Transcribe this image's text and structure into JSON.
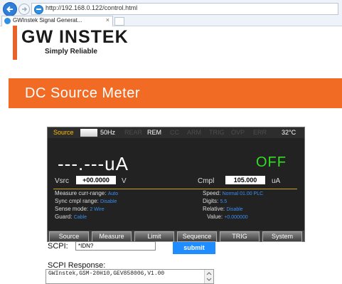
{
  "browser": {
    "url": "http://192.168.0.122/control.html",
    "tab_title": "GWInstek Signal Generat...",
    "tab_close": "×"
  },
  "header": {
    "logo_text": "GW INSTEK",
    "slogan": "Simply  Reliable",
    "page_title": "DC Source Meter",
    "brand_color": "#f26b25"
  },
  "instrument": {
    "status": {
      "source": "Source",
      "freq": "50Hz",
      "rear": "REAR",
      "rem": "REM",
      "cc": "CC",
      "arm": "ARM",
      "trig": "TRIG",
      "ovp": "OVP",
      "err": "ERR",
      "temp": "32°C"
    },
    "reading": "---.---uA",
    "output_state": "OFF",
    "vsrc_label": "Vsrc",
    "vsrc_value": "+00.0000",
    "vsrc_unit": "V",
    "cmpl_label": "Cmpl",
    "cmpl_value": "105.000",
    "cmpl_unit": "uA",
    "settings": {
      "measure_range_label": "Measure curr-range:",
      "measure_range_value": "Auto",
      "sync_cmpl_label": "Sync cmpl range:",
      "sync_cmpl_value": "Disable",
      "sense_label": "Sense mode:",
      "sense_value": "2 Wire",
      "guard_label": "Guard:",
      "guard_value": "Cable",
      "speed_label": "Speed:",
      "speed_value": "Normal  01.00 PLC",
      "digits_label": "Digits:",
      "digits_value": "5.5",
      "relative_label": "Relative:",
      "relative_value": "Disable",
      "value_label": "Value:",
      "value_value": "+0.000000"
    },
    "softkeys": [
      "Source",
      "Measure",
      "Limit",
      "Sequence",
      "TRIG",
      "System"
    ]
  },
  "scpi": {
    "label": "SCPI:",
    "input_value": "*IDN?",
    "submit_label": "submit",
    "response_label": "SCPI Response:",
    "response_text": "GWInstek,GSM-20H10,GEV858006,V1.00"
  }
}
